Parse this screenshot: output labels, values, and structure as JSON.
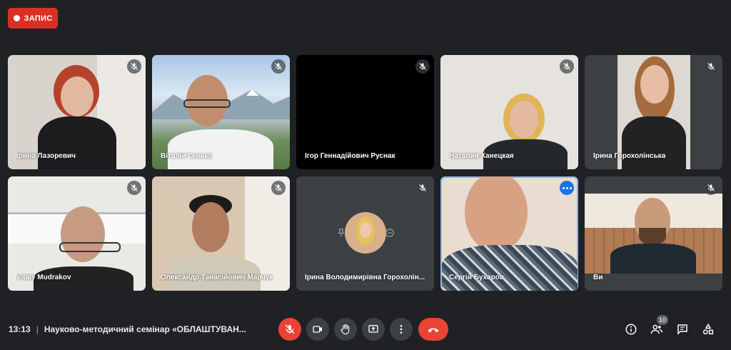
{
  "recording": {
    "label": "ЗАПИС",
    "color": "#d93025"
  },
  "participants": [
    {
      "name": "Ірина Лазоревич",
      "mic": "off"
    },
    {
      "name": "Віталій Гунько",
      "mic": "off"
    },
    {
      "name": "Ігор Геннадійович Руснак",
      "mic": "off"
    },
    {
      "name": "Наталия Ханецкая",
      "mic": "off"
    },
    {
      "name": "Ірина Горохолінська",
      "mic": "off"
    },
    {
      "name": "Vitaly Mudrakov",
      "mic": "off"
    },
    {
      "name": "Олександр Танасійович Марчук",
      "mic": "off"
    },
    {
      "name": "Ірина Володимирівна Горохолін...",
      "mic": "off"
    },
    {
      "name": "Сергій Бухаров",
      "mic": "speaking"
    },
    {
      "name": "Ви",
      "mic": "off"
    }
  ],
  "bottom_bar": {
    "time": "13:13",
    "meeting_title": "Науково-методичний семінар «ОБЛАШТУВАН...",
    "controls": [
      "mic-off-icon",
      "camera-icon",
      "raise-hand-icon",
      "present-screen-icon",
      "more-options-icon",
      "hang-up-icon"
    ],
    "right_controls": [
      "info-icon",
      "people-icon",
      "chat-icon",
      "activities-icon"
    ],
    "participant_count": "10"
  },
  "colors": {
    "background": "#202124",
    "tile": "#3c4043",
    "danger": "#ea4335",
    "speaking": "#1a73e8"
  }
}
